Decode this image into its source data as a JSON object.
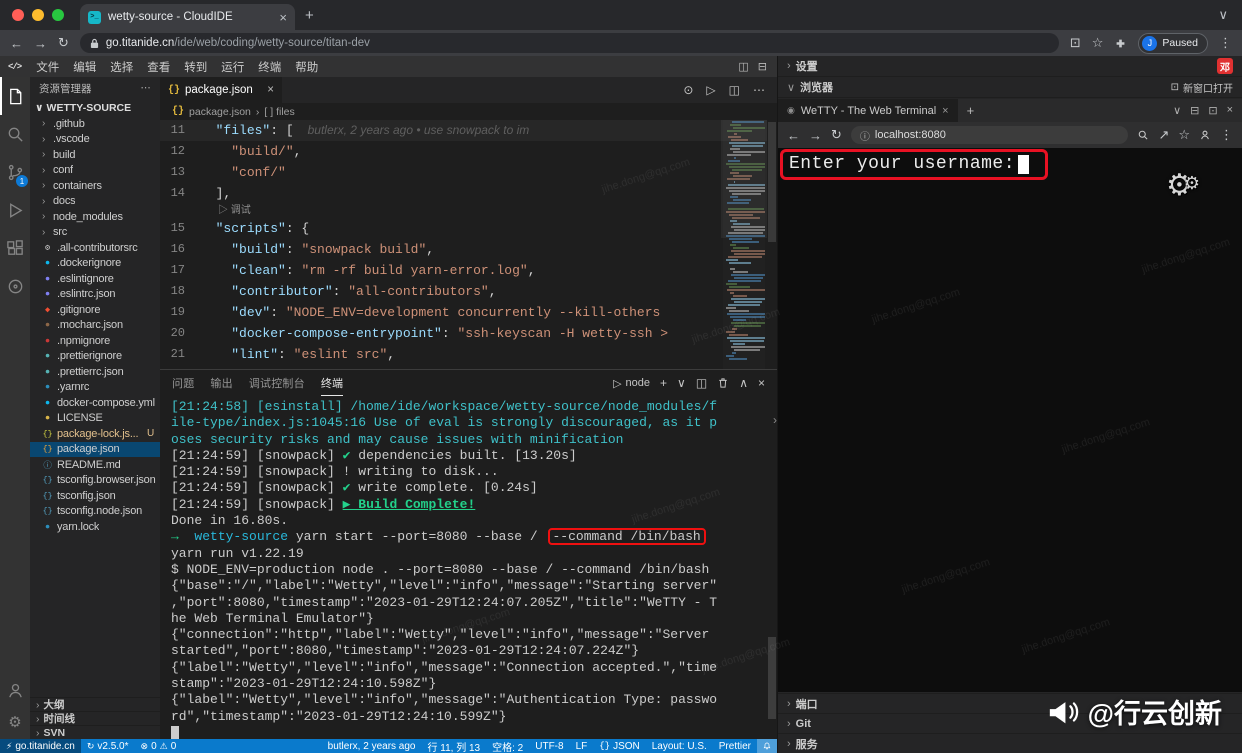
{
  "mac_browser": {
    "tab_title": "wetty-source - CloudIDE",
    "url_domain": "go.titanide.cn",
    "url_path": "/ide/web/coding/wetty-source/titan-dev",
    "profile_initial": "J",
    "profile_label": "Paused"
  },
  "menubar": {
    "logo": "</>",
    "items": [
      "文件",
      "编辑",
      "选择",
      "查看",
      "转到",
      "运行",
      "终端",
      "帮助"
    ]
  },
  "sidebar": {
    "title": "资源管理器",
    "section": "WETTY-SOURCE",
    "scm_badge": "1",
    "items": [
      {
        "name": ".github",
        "type": "folder"
      },
      {
        "name": ".vscode",
        "type": "folder"
      },
      {
        "name": "build",
        "type": "folder"
      },
      {
        "name": "conf",
        "type": "folder"
      },
      {
        "name": "containers",
        "type": "folder"
      },
      {
        "name": "docs",
        "type": "folder"
      },
      {
        "name": "node_modules",
        "type": "folder"
      },
      {
        "name": "src",
        "type": "folder"
      },
      {
        "name": ".all-contributorsrc",
        "type": "file",
        "glyph": "⚙",
        "color": "#c5c5c5"
      },
      {
        "name": ".dockerignore",
        "type": "file",
        "glyph": "●",
        "color": "#0db7ed"
      },
      {
        "name": ".eslintignore",
        "type": "file",
        "glyph": "●",
        "color": "#8080f2"
      },
      {
        "name": ".eslintrc.json",
        "type": "file",
        "glyph": "●",
        "color": "#8080f2"
      },
      {
        "name": ".gitignore",
        "type": "file",
        "glyph": "◆",
        "color": "#f14e32"
      },
      {
        "name": ".mocharc.json",
        "type": "file",
        "glyph": "●",
        "color": "#8d6748"
      },
      {
        "name": ".npmignore",
        "type": "file",
        "glyph": "●",
        "color": "#cb3837"
      },
      {
        "name": ".prettierignore",
        "type": "file",
        "glyph": "●",
        "color": "#56b3b4"
      },
      {
        "name": ".prettierrc.json",
        "type": "file",
        "glyph": "●",
        "color": "#56b3b4"
      },
      {
        "name": ".yarnrc",
        "type": "file",
        "glyph": "●",
        "color": "#2c8ebb"
      },
      {
        "name": "docker-compose.yml",
        "type": "file",
        "glyph": "●",
        "color": "#0db7ed"
      },
      {
        "name": "LICENSE",
        "type": "file",
        "glyph": "●",
        "color": "#d9b54a"
      },
      {
        "name": "package-lock.js...",
        "type": "file",
        "glyph": "{}",
        "color": "#cbcb41",
        "badge": "U",
        "modified": true
      },
      {
        "name": "package.json",
        "type": "file",
        "glyph": "{}",
        "color": "#e8a33d",
        "selected": true
      },
      {
        "name": "README.md",
        "type": "file",
        "glyph": "ⓘ",
        "color": "#519aba"
      },
      {
        "name": "tsconfig.browser.json",
        "type": "file",
        "glyph": "{}",
        "color": "#519aba"
      },
      {
        "name": "tsconfig.json",
        "type": "file",
        "glyph": "{}",
        "color": "#519aba"
      },
      {
        "name": "tsconfig.node.json",
        "type": "file",
        "glyph": "{}",
        "color": "#519aba"
      },
      {
        "name": "yarn.lock",
        "type": "file",
        "glyph": "●",
        "color": "#2c8ebb"
      }
    ],
    "bottom_sections": [
      "大纲",
      "时间线",
      "SVN"
    ]
  },
  "editor": {
    "tab_label": "package.json",
    "breadcrumb_file": "package.json",
    "breadcrumb_node": "[ ] files",
    "blame": "butlerx, 2 years ago • use snowpack to im",
    "codelens": "调试",
    "lines": [
      {
        "n": 11,
        "current": true,
        "blame": true,
        "segs": [
          [
            "p",
            "  "
          ],
          [
            "k",
            "\"files\""
          ],
          [
            "p",
            ": ["
          ]
        ]
      },
      {
        "n": 12,
        "segs": [
          [
            "p",
            "    "
          ],
          [
            "s",
            "\"build/\""
          ],
          [
            "p",
            ","
          ]
        ]
      },
      {
        "n": 13,
        "segs": [
          [
            "p",
            "    "
          ],
          [
            "s",
            "\"conf/\""
          ]
        ]
      },
      {
        "n": 14,
        "segs": [
          [
            "p",
            "  ],"
          ]
        ]
      },
      {
        "lens": true
      },
      {
        "n": 15,
        "segs": [
          [
            "p",
            "  "
          ],
          [
            "k",
            "\"scripts\""
          ],
          [
            "p",
            ": {"
          ]
        ]
      },
      {
        "n": 16,
        "segs": [
          [
            "p",
            "    "
          ],
          [
            "k",
            "\"build\""
          ],
          [
            "p",
            ": "
          ],
          [
            "s",
            "\"snowpack build\""
          ],
          [
            "p",
            ","
          ]
        ]
      },
      {
        "n": 17,
        "segs": [
          [
            "p",
            "    "
          ],
          [
            "k",
            "\"clean\""
          ],
          [
            "p",
            ": "
          ],
          [
            "s",
            "\"rm -rf build yarn-error.log\""
          ],
          [
            "p",
            ","
          ]
        ]
      },
      {
        "n": 18,
        "segs": [
          [
            "p",
            "    "
          ],
          [
            "k",
            "\"contributor\""
          ],
          [
            "p",
            ": "
          ],
          [
            "s",
            "\"all-contributors\""
          ],
          [
            "p",
            ","
          ]
        ]
      },
      {
        "n": 19,
        "segs": [
          [
            "p",
            "    "
          ],
          [
            "k",
            "\"dev\""
          ],
          [
            "p",
            ": "
          ],
          [
            "s",
            "\"NODE_ENV=development concurrently --kill-others"
          ]
        ]
      },
      {
        "n": 20,
        "segs": [
          [
            "p",
            "    "
          ],
          [
            "k",
            "\"docker-compose-entrypoint\""
          ],
          [
            "p",
            ": "
          ],
          [
            "s",
            "\"ssh-keyscan -H wetty-ssh >"
          ]
        ]
      },
      {
        "n": 21,
        "segs": [
          [
            "p",
            "    "
          ],
          [
            "k",
            "\"lint\""
          ],
          [
            "p",
            ": "
          ],
          [
            "s",
            "\"eslint src\""
          ],
          [
            "p",
            ","
          ]
        ]
      }
    ]
  },
  "panel": {
    "tabs": [
      "问题",
      "输出",
      "调试控制台",
      "终端"
    ],
    "active_index": 3,
    "shell_label": "node",
    "terminal_lines": [
      [
        {
          "c": "cyan",
          "t": "[21:24:58] [esinstall] /home/ide/workspace/wetty-source/node_modules/f"
        }
      ],
      [
        {
          "c": "cyan",
          "t": "ile-type/index.js:1045:16 Use of eval is strongly discouraged, as it p"
        }
      ],
      [
        {
          "c": "cyan",
          "t": "oses security risks and may cause issues with minification"
        }
      ],
      [
        {
          "t": "[21:24:59] [snowpack] "
        },
        {
          "c": "green",
          "t": "✔"
        },
        {
          "t": " dependencies built. [13.20s]"
        }
      ],
      [
        {
          "t": "[21:24:59] [snowpack] ! writing to disk..."
        }
      ],
      [
        {
          "t": "[21:24:59] [snowpack] "
        },
        {
          "c": "green",
          "t": "✔"
        },
        {
          "t": " write complete. [0.24s]"
        }
      ],
      [
        {
          "t": "[21:24:59] [snowpack] "
        },
        {
          "c": "greenu",
          "t": "▶ Build Complete!"
        }
      ],
      [
        {
          "t": "Done in 16.80s."
        }
      ],
      [
        {
          "c": "green",
          "t": "→"
        },
        {
          "t": "  "
        },
        {
          "c": "cyanb",
          "t": "wetty-source"
        },
        {
          "t": " yarn start --port=8080 --base / "
        },
        {
          "box": true,
          "t": "--command /bin/bash"
        }
      ],
      [
        {
          "t": "yarn run v1.22.19"
        }
      ],
      [
        {
          "t": "$ NODE_ENV=production node . --port=8080 --base / --command /bin/bash"
        }
      ],
      [
        {
          "t": "{\"base\":\"/\",\"label\":\"Wetty\",\"level\":\"info\",\"message\":\"Starting server\""
        }
      ],
      [
        {
          "t": ",\"port\":8080,\"timestamp\":\"2023-01-29T12:24:07.205Z\",\"title\":\"WeTTY - T"
        }
      ],
      [
        {
          "t": "he Web Terminal Emulator\"}"
        }
      ],
      [
        {
          "t": "{\"connection\":\"http\",\"label\":\"Wetty\",\"level\":\"info\",\"message\":\"Server"
        }
      ],
      [
        {
          "t": "started\",\"port\":8080,\"timestamp\":\"2023-01-29T12:24:07.224Z\"}"
        }
      ],
      [
        {
          "t": "{\"label\":\"Wetty\",\"level\":\"info\",\"message\":\"Connection accepted.\",\"time"
        }
      ],
      [
        {
          "t": "stamp\":\"2023-01-29T12:24:10.598Z\"}"
        }
      ],
      [
        {
          "t": "{\"label\":\"Wetty\",\"level\":\"info\",\"message\":\"Authentication Type: passwo"
        }
      ],
      [
        {
          "t": "rd\",\"timestamp\":\"2023-01-29T12:24:10.599Z\"}"
        }
      ],
      [
        {
          "cur": true,
          "t": " "
        }
      ]
    ]
  },
  "right": {
    "settings": "设置",
    "browser": "浏览器",
    "open_new": "新窗口打开",
    "user_badge": "邓",
    "web_tab": "WeTTY - The Web Terminal",
    "web_url": "localhost:8080",
    "prompt": "Enter your username:",
    "sections": [
      "端口",
      "Git",
      "服务"
    ]
  },
  "statusbar": {
    "remote": "go.titanide.cn",
    "version": "v2.5.0*",
    "errors": "0",
    "warnings": "0",
    "blame": "butlerx, 2 years ago",
    "cursor": "行 11, 列 13",
    "indent": "空格: 2",
    "encoding": "UTF-8",
    "eol": "LF",
    "lang": "JSON",
    "layout": "Layout: U.S.",
    "formatter": "Prettier"
  },
  "watermark": {
    "brand": "@行云创新",
    "faint": "jihe.dong@qq.com"
  }
}
